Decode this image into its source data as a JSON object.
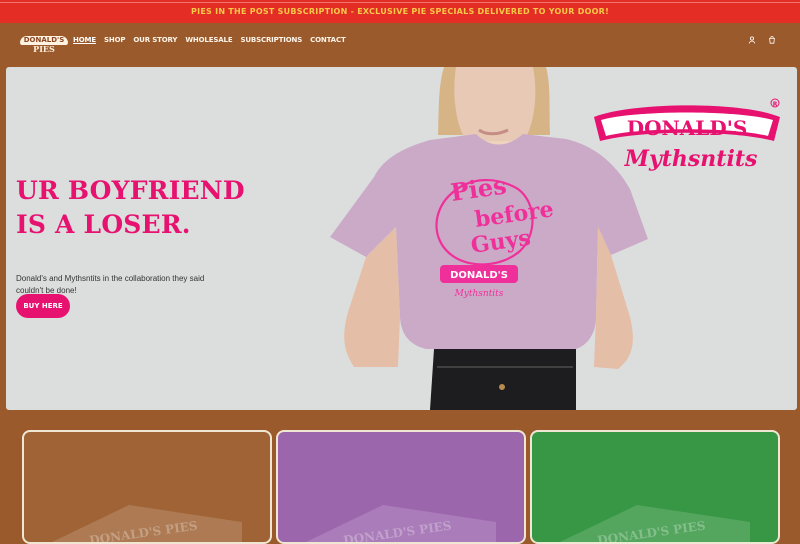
{
  "announcement": {
    "text": "PIES IN THE POST SUBSCRIPTION - EXCLUSIVE PIE SPECIALS DELIVERED TO YOUR DOOR!"
  },
  "header": {
    "logo": {
      "top": "DONALD'S",
      "bottom": "PIES"
    },
    "nav": [
      {
        "label": "HOME"
      },
      {
        "label": "SHOP"
      },
      {
        "label": "OUR STORY"
      },
      {
        "label": "WHOLESALE"
      },
      {
        "label": "SUBSCRIPTIONS"
      },
      {
        "label": "CONTACT"
      }
    ],
    "icons": [
      "user-icon",
      "cart-icon"
    ]
  },
  "hero": {
    "headline": "UR BOYFRIEND IS A LOSER.",
    "subtext": "Donald's and Mythsntits in the collaboration they said couldn't be done!",
    "button_label": "BUY HERE",
    "brand_logo": {
      "line1": "DONALD'S",
      "line2": "Mythsntits"
    },
    "shirt_print": {
      "line1": "Pies",
      "line2": "before",
      "line3": "Guys",
      "badge": "DONALD'S",
      "badge_sub": "Mythsntits"
    }
  },
  "cards": [
    {
      "color": "#9f6335",
      "box_label": "DONALD'S PIES"
    },
    {
      "color": "#9c66ad",
      "box_label": "DONALD'S PIES"
    },
    {
      "color": "#379744",
      "box_label": "DONALD'S PIES"
    }
  ],
  "colors": {
    "page_background": "#9a5a2c",
    "announcement_bg": "#e32d25",
    "announcement_text": "#f7c948",
    "accent_pink": "#e7116f",
    "hero_bg": "#dcdede"
  }
}
